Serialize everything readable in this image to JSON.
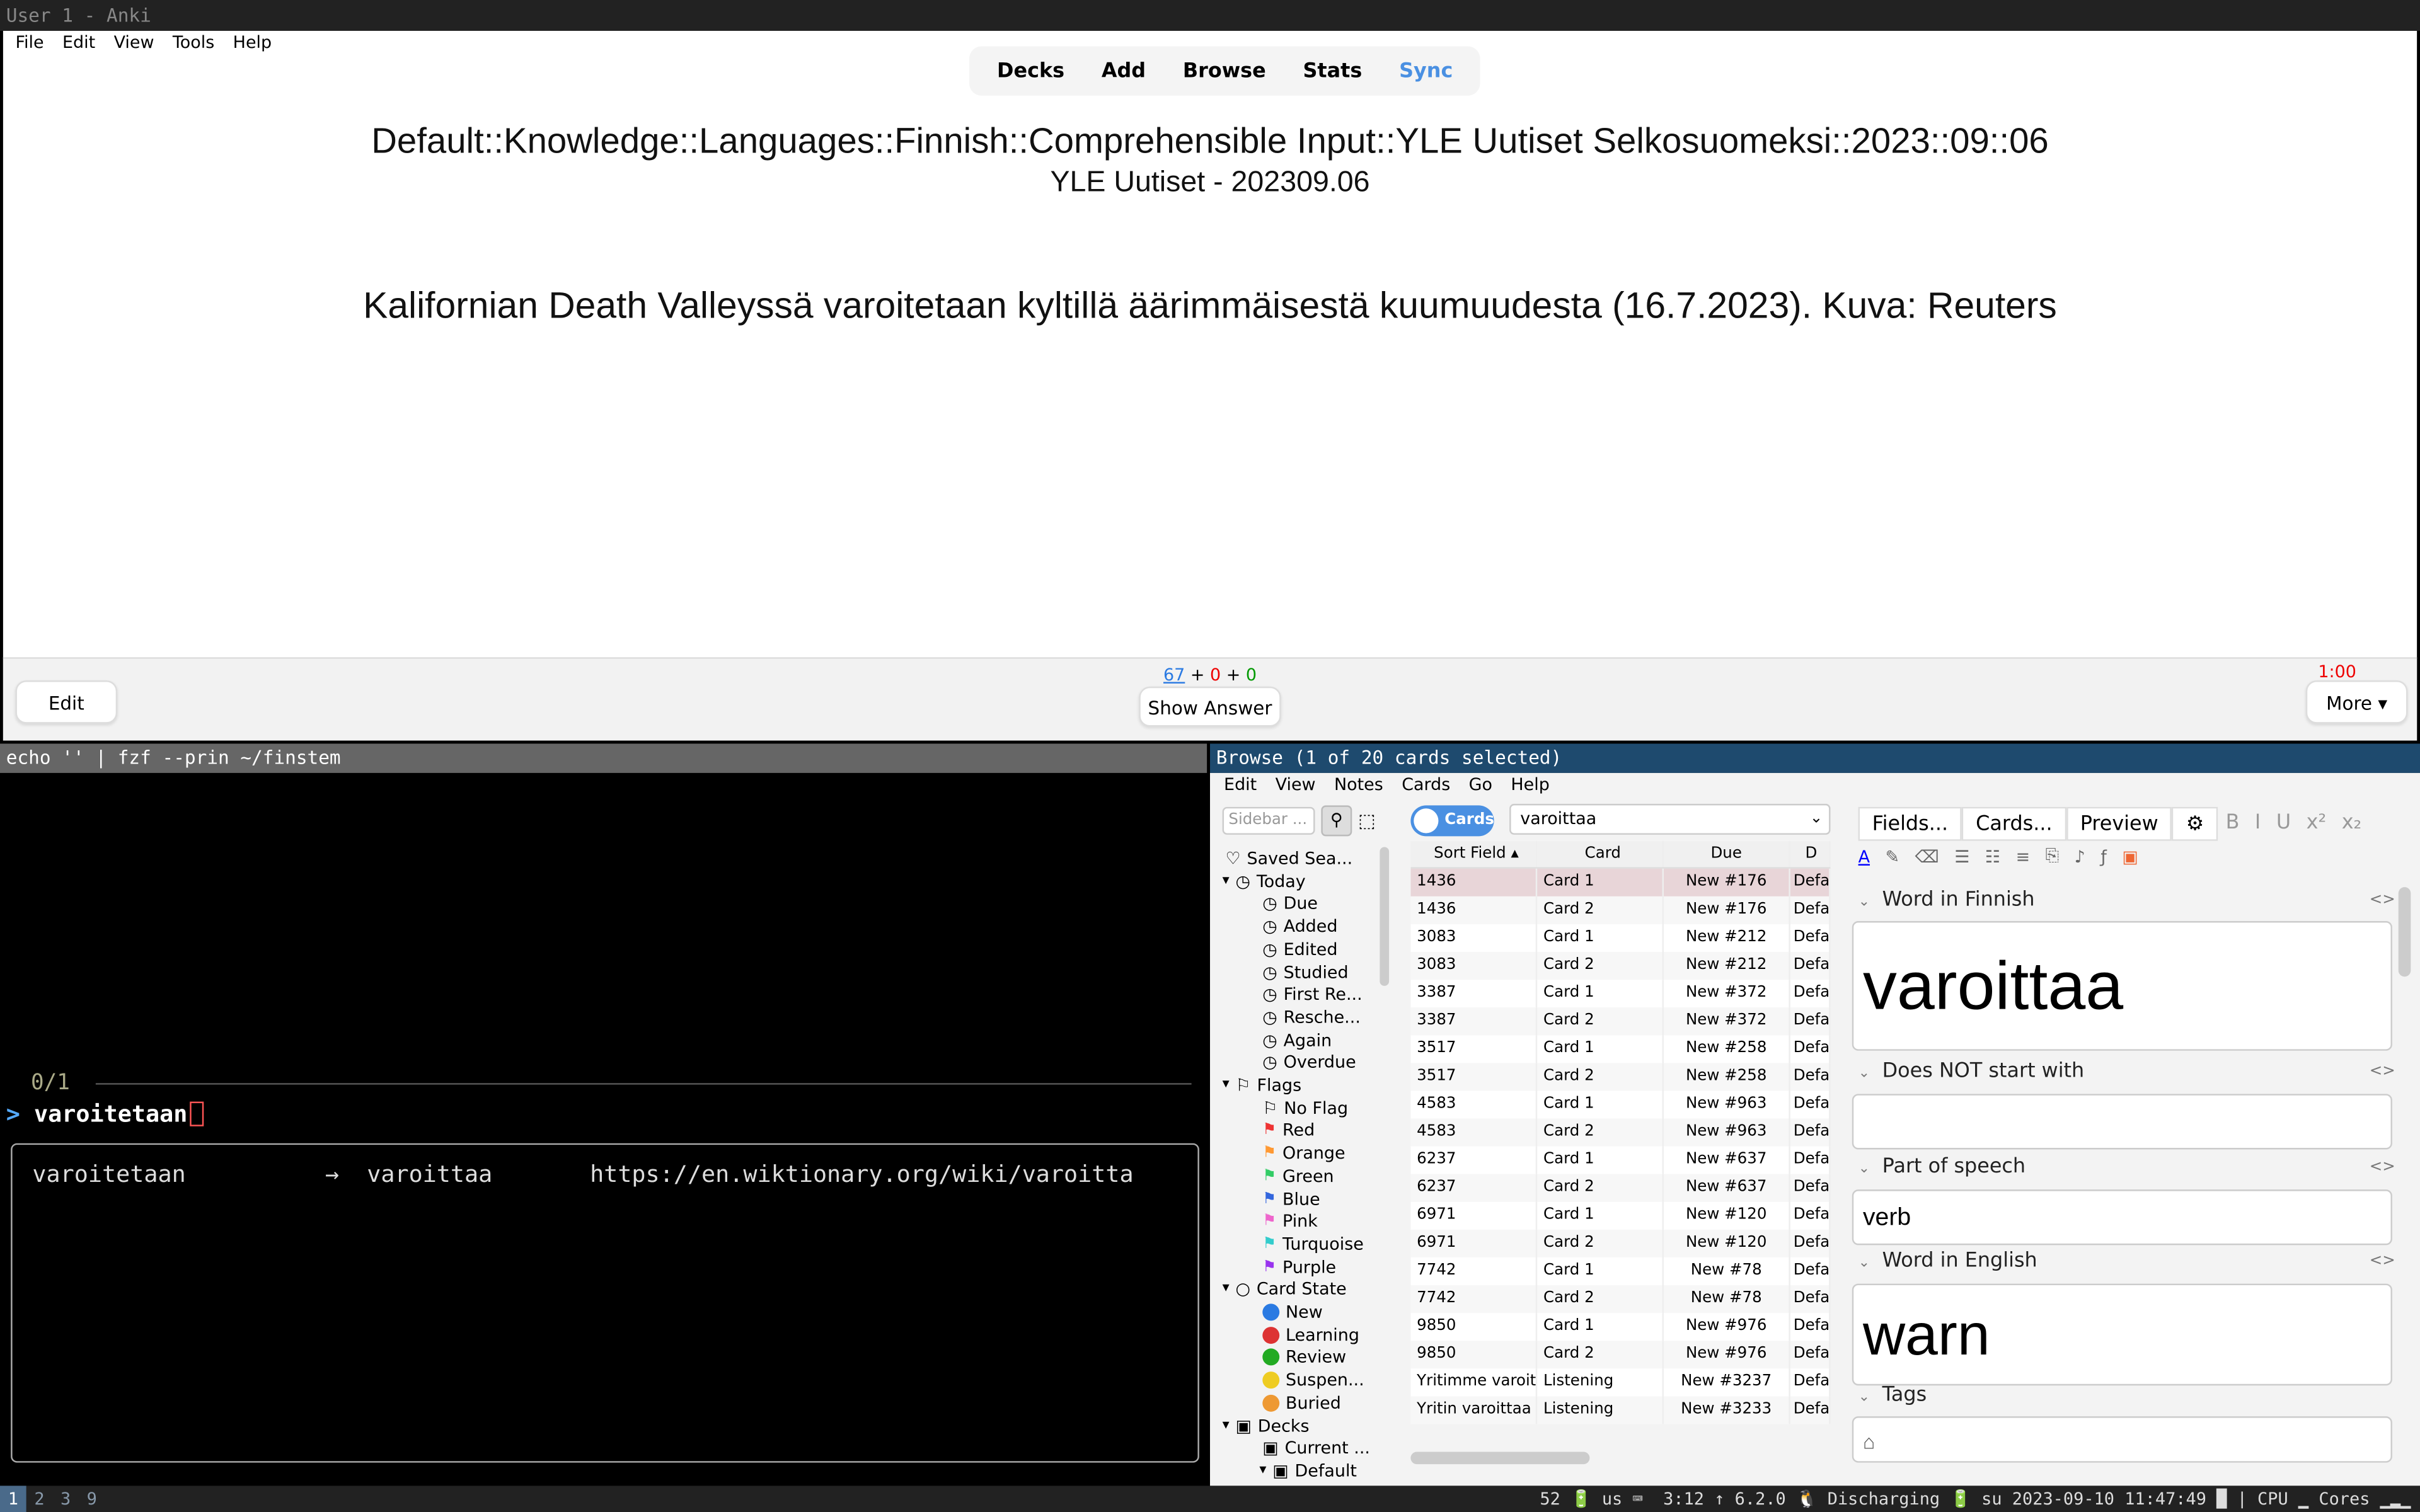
{
  "window_title": "User 1 - Anki",
  "menu": [
    "File",
    "Edit",
    "View",
    "Tools",
    "Help"
  ],
  "nav": [
    "Decks",
    "Add",
    "Browse",
    "Stats",
    "Sync"
  ],
  "colors": {
    "sync": "#4a90e2",
    "red": "#e00000",
    "green": "#090"
  },
  "deck_path": "Default::Knowledge::Languages::Finnish::Comprehensible Input::YLE Uutiset Selkosuomeksi::2023::09::06",
  "subtitle": "YLE Uutiset - 202309.06",
  "sentence": "Kalifornian Death Valleyssä varoitetaan kyltillä äärimmäisestä kuumuudesta (16.7.2023). Kuva: Reuters",
  "counts": {
    "new": "67",
    "plus1": " + ",
    "learn": "0",
    "plus2": " + ",
    "review": "0"
  },
  "timer": "1:00",
  "edit_label": "Edit",
  "show_answer_label": "Show Answer",
  "more_label": "More ▾",
  "terminal": {
    "title": "echo '' | fzf --prin ~/finstem",
    "count": "0/1",
    "prompt_symbol": ">",
    "query": "varoitetaan",
    "result": "varoitetaan          →  varoittaa       https://en.wiktionary.org/wiki/varoitta"
  },
  "browse": {
    "title": "Browse (1 of 20 cards selected)",
    "menu": [
      "Edit",
      "View",
      "Notes",
      "Cards",
      "Go",
      "Help"
    ],
    "sidebar_placeholder": "Sidebar ...",
    "toggle_label": "Cards",
    "search_value": "varoittaa",
    "sidebar": [
      {
        "label": "Saved Sea...",
        "indent": 0,
        "icon": "♡"
      },
      {
        "label": "Today",
        "indent": 0,
        "icon": "◷",
        "arrow": "▾"
      },
      {
        "label": "Due",
        "indent": 1,
        "icon": "◷"
      },
      {
        "label": "Added",
        "indent": 1,
        "icon": "◷"
      },
      {
        "label": "Edited",
        "indent": 1,
        "icon": "◷"
      },
      {
        "label": "Studied",
        "indent": 1,
        "icon": "◷"
      },
      {
        "label": "First Re...",
        "indent": 1,
        "icon": "◷"
      },
      {
        "label": "Resche...",
        "indent": 1,
        "icon": "◷"
      },
      {
        "label": "Again",
        "indent": 1,
        "icon": "◷"
      },
      {
        "label": "Overdue",
        "indent": 1,
        "icon": "◷"
      },
      {
        "label": "Flags",
        "indent": 0,
        "icon": "⚐",
        "arrow": "▾"
      },
      {
        "label": "No Flag",
        "indent": 1,
        "icon": "⚐"
      },
      {
        "label": "Red",
        "indent": 1,
        "flag": "#e33"
      },
      {
        "label": "Orange",
        "indent": 1,
        "flag": "#f93"
      },
      {
        "label": "Green",
        "indent": 1,
        "flag": "#3c6"
      },
      {
        "label": "Blue",
        "indent": 1,
        "flag": "#36d"
      },
      {
        "label": "Pink",
        "indent": 1,
        "flag": "#e6c"
      },
      {
        "label": "Turquoise",
        "indent": 1,
        "flag": "#3cc"
      },
      {
        "label": "Purple",
        "indent": 1,
        "flag": "#93e"
      },
      {
        "label": "Card State",
        "indent": 0,
        "icon": "○",
        "arrow": "▾"
      },
      {
        "label": "New",
        "indent": 1,
        "dot": "#2a7ae2"
      },
      {
        "label": "Learning",
        "indent": 1,
        "dot": "#d33"
      },
      {
        "label": "Review",
        "indent": 1,
        "dot": "#2a2"
      },
      {
        "label": "Suspen...",
        "indent": 1,
        "dot": "#ec2"
      },
      {
        "label": "Buried",
        "indent": 1,
        "dot": "#e93"
      },
      {
        "label": "Decks",
        "indent": 0,
        "icon": "▣",
        "arrow": "▾"
      },
      {
        "label": "Current ...",
        "indent": 1,
        "icon": "▣"
      },
      {
        "label": "Default",
        "indent": 1,
        "icon": "▣",
        "arrow": "▾"
      }
    ],
    "columns": [
      "Sort Field ▴",
      "Card",
      "Due",
      "D"
    ],
    "rows": [
      [
        "1436",
        "Card 1",
        "New #176",
        "Defa"
      ],
      [
        "1436",
        "Card 2",
        "New #176",
        "Defa"
      ],
      [
        "3083",
        "Card 1",
        "New #212",
        "Defa"
      ],
      [
        "3083",
        "Card 2",
        "New #212",
        "Defa"
      ],
      [
        "3387",
        "Card 1",
        "New #372",
        "Defa"
      ],
      [
        "3387",
        "Card 2",
        "New #372",
        "Defa"
      ],
      [
        "3517",
        "Card 1",
        "New #258",
        "Defa"
      ],
      [
        "3517",
        "Card 2",
        "New #258",
        "Defa"
      ],
      [
        "4583",
        "Card 1",
        "New #963",
        "Defa"
      ],
      [
        "4583",
        "Card 2",
        "New #963",
        "Defa"
      ],
      [
        "6237",
        "Card 1",
        "New #637",
        "Defa"
      ],
      [
        "6237",
        "Card 2",
        "New #637",
        "Defa"
      ],
      [
        "6971",
        "Card 1",
        "New #120",
        "Defa"
      ],
      [
        "6971",
        "Card 2",
        "New #120",
        "Defa"
      ],
      [
        "7742",
        "Card 1",
        "New #78",
        "Defa"
      ],
      [
        "7742",
        "Card 2",
        "New #78",
        "Defa"
      ],
      [
        "9850",
        "Card 1",
        "New #976",
        "Defa"
      ],
      [
        "9850",
        "Card 2",
        "New #976",
        "Defa"
      ],
      [
        "Yritimme varoit...",
        "Listening",
        "New #3237",
        "Defa"
      ],
      [
        "Yritin varoittaa ...",
        "Listening",
        "New #3233",
        "Defa"
      ]
    ],
    "editor": {
      "buttons": [
        "Fields...",
        "Cards...",
        "Preview"
      ],
      "fields": [
        {
          "label": "Word in Finnish",
          "value": "varoittaa"
        },
        {
          "label": "Does NOT start with",
          "value": ""
        },
        {
          "label": "Part of speech",
          "value": "verb"
        },
        {
          "label": "Word in English",
          "value": "warn"
        },
        {
          "label": "Tags",
          "value": ""
        }
      ]
    }
  },
  "statusbar": {
    "workspaces": [
      "1",
      "2",
      "3",
      "9"
    ],
    "right": "52 🔋 us ⌨  3:12 ↑ 6.2.0 🐧 Discharging 🔋 su 2023-09-10 11:47:49 █ | CPU ▁ Cores ▁▂▁"
  }
}
